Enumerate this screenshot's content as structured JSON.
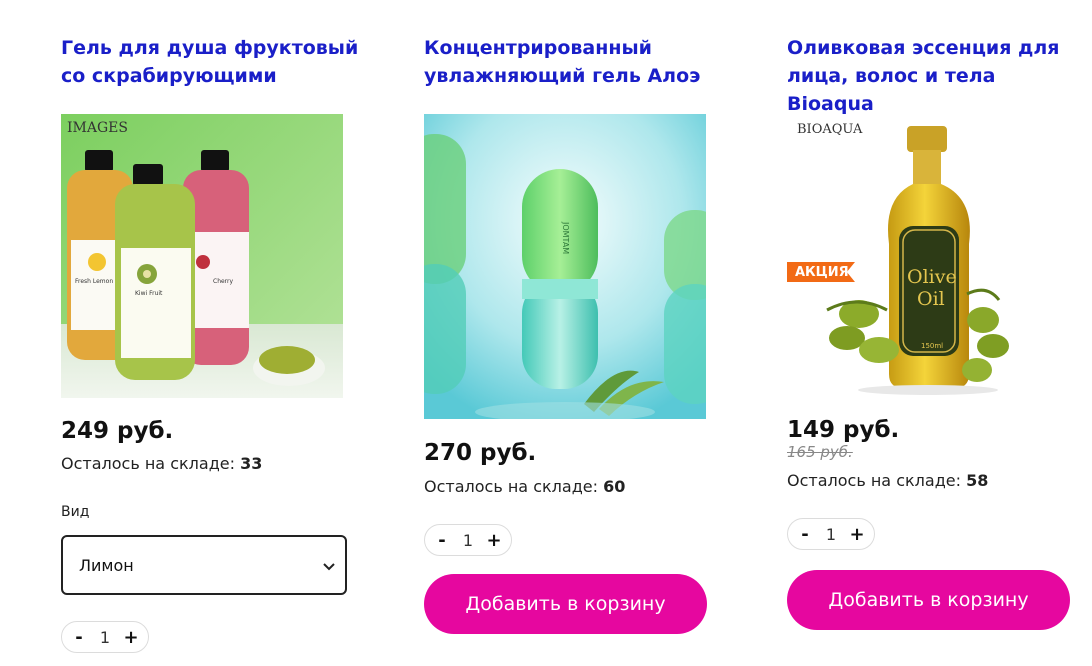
{
  "products": [
    {
      "title": "Гель для душа фруктовый со скрабирующими",
      "price": "249 руб.",
      "stock_label": "Осталось на складе:",
      "stock_value": "33",
      "option_label": "Вид",
      "option_value": "Лимон",
      "quantity": "1",
      "image_brand": "IMAGES",
      "image_label_1": "Fresh Lemon",
      "image_label_2": "Kiwi Fruit",
      "image_label_3": "Cherry"
    },
    {
      "title": "Концентрированный увлажняющий гель Алоэ",
      "price": "270 руб.",
      "stock_label": "Осталось на складе:",
      "stock_value": "60",
      "quantity": "1",
      "add_label": "Добавить в корзину",
      "image_brand": "JOMTAM"
    },
    {
      "title": "Оливковая эссенция для лица, волос и тела Bioaqua",
      "price": "149 руб.",
      "old_price": "165 руб.",
      "stock_label": "Осталось на складе:",
      "stock_value": "58",
      "quantity": "1",
      "add_label": "Добавить в корзину",
      "badge": "АКЦИЯ",
      "image_brand": "BIOAQUA",
      "image_label_1": "Olive",
      "image_label_2": "Oil",
      "image_label_3": "150ml"
    }
  ],
  "stepper": {
    "minus": "-",
    "plus": "+"
  },
  "icons": {
    "select_arrow": "chevron-down-icon"
  },
  "colors": {
    "title": "#1a1fc8",
    "button": "#e6079f",
    "badge": "#f26a15"
  }
}
